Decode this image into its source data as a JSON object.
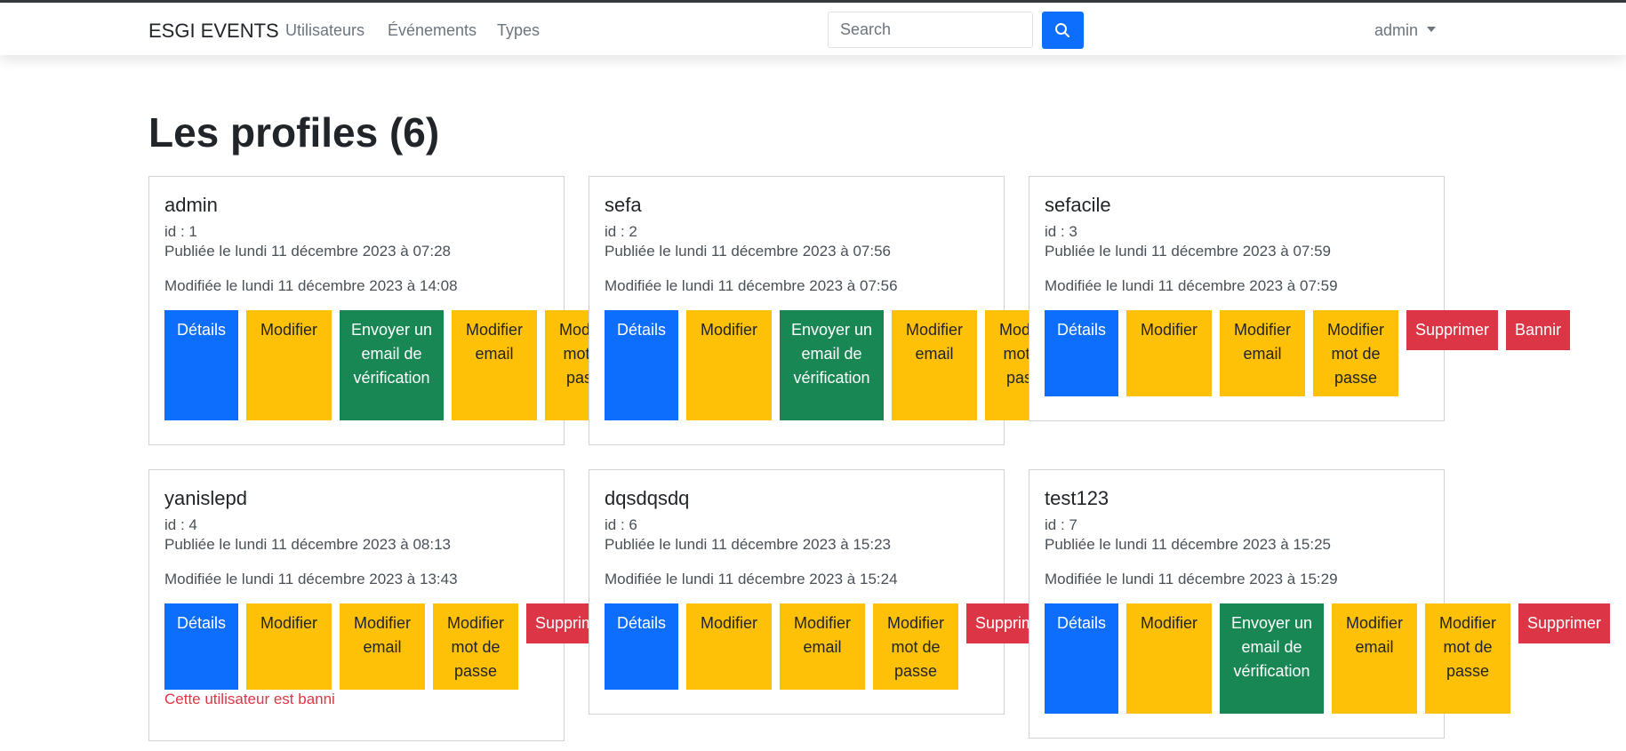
{
  "navbar": {
    "brand": "ESGI EVENTS",
    "links": [
      "Utilisateurs",
      "Événements",
      "Types"
    ],
    "search_placeholder": "Search",
    "user": "admin"
  },
  "page": {
    "title": "Les profiles (6)"
  },
  "labels": {
    "details": "Détails",
    "modifier": "Modifier",
    "envoyer": "Envoyer un email de vérification",
    "modifier_email": "Modifier email",
    "modifier_mdp": "Modifier mot de passe",
    "supprimer": "Supprimer",
    "bannir": "Bannir"
  },
  "profiles": [
    {
      "name": "admin",
      "id": "id : 1",
      "published": "Publiée le lundi 11 décembre 2023 à 07:28",
      "modified": "Modifiée le lundi 11 décembre 2023 à 14:08"
    },
    {
      "name": "sefa",
      "id": "id : 2",
      "published": "Publiée le lundi 11 décembre 2023 à 07:56",
      "modified": "Modifiée le lundi 11 décembre 2023 à 07:56"
    },
    {
      "name": "sefacile",
      "id": "id : 3",
      "published": "Publiée le lundi 11 décembre 2023 à 07:59",
      "modified": "Modifiée le lundi 11 décembre 2023 à 07:59"
    },
    {
      "name": "yanislepd",
      "id": "id : 4",
      "published": "Publiée le lundi 11 décembre 2023 à 08:13",
      "modified": "Modifiée le lundi 11 décembre 2023 à 13:43",
      "banned_text": "Cette utilisateur est banni"
    },
    {
      "name": "dqsdqsdq",
      "id": "id : 6",
      "published": "Publiée le lundi 11 décembre 2023 à 15:23",
      "modified": "Modifiée le lundi 11 décembre 2023 à 15:24"
    },
    {
      "name": "test123",
      "id": "id : 7",
      "published": "Publiée le lundi 11 décembre 2023 à 15:25",
      "modified": "Modifiée le lundi 11 décembre 2023 à 15:29"
    }
  ],
  "colors": {
    "primary": "#0d6efd",
    "warning": "#ffc107",
    "success": "#198754",
    "danger": "#dc3545"
  }
}
